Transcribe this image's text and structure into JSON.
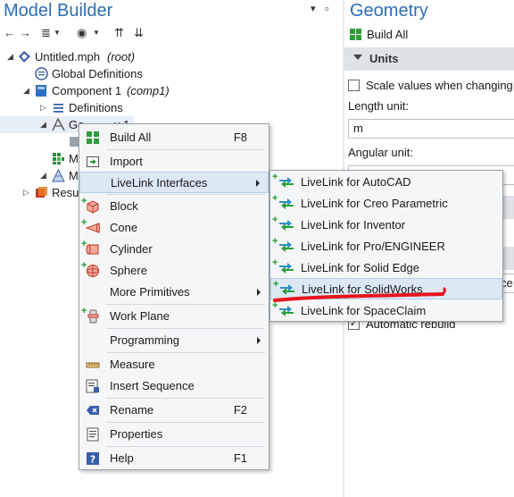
{
  "left_panel": {
    "title": "Model Builder",
    "pin_glyph": "▾",
    "close_glyph": "▫",
    "toolbar_icons": [
      "arrow-left-icon",
      "arrow-right-icon",
      "list-icon",
      "eye-icon",
      "sort-up-icon",
      "sort-down-icon"
    ]
  },
  "tree": {
    "root_label": "Untitled.mph",
    "root_tag": "(root)",
    "global_definitions": "Global Definitions",
    "component_label": "Component 1",
    "component_tag": "(comp1)",
    "definitions": "Definitions",
    "geometry_partial": "Ge",
    "geometry_partial_tail": "y 1",
    "mat_partial": "M",
    "mesh_partial": "M",
    "results_partial": "Resu"
  },
  "right_panel": {
    "title": "Geometry",
    "build_all": "Build All",
    "units_section": "Units",
    "scale_checkbox_label": "Scale values when changing u",
    "length_unit_label": "Length unit:",
    "length_unit_value": "m",
    "angular_unit_label": "Angular unit:",
    "tolerance_partial": "ce:",
    "auto_rebuild_label": "Automatic rebuild"
  },
  "context_menu": {
    "items": [
      {
        "label": "Build All",
        "shortcut": "F8",
        "icon": "build-all-icon"
      },
      {
        "label": "Import",
        "shortcut": "",
        "icon": "import-icon"
      },
      {
        "label": "LiveLink Interfaces",
        "shortcut": "",
        "icon": ""
      },
      {
        "label": "Block",
        "shortcut": "",
        "icon": "block-icon"
      },
      {
        "label": "Cone",
        "shortcut": "",
        "icon": "cone-icon"
      },
      {
        "label": "Cylinder",
        "shortcut": "",
        "icon": "cylinder-icon"
      },
      {
        "label": "Sphere",
        "shortcut": "",
        "icon": "sphere-icon"
      },
      {
        "label": "More Primitives",
        "shortcut": "",
        "icon": ""
      },
      {
        "label": "Work Plane",
        "shortcut": "",
        "icon": "work-plane-icon"
      },
      {
        "label": "Programming",
        "shortcut": "",
        "icon": ""
      },
      {
        "label": "Measure",
        "shortcut": "",
        "icon": "measure-icon"
      },
      {
        "label": "Insert Sequence",
        "shortcut": "",
        "icon": "insert-sequence-icon"
      },
      {
        "label": "Rename",
        "shortcut": "F2",
        "icon": "rename-icon"
      },
      {
        "label": "Properties",
        "shortcut": "",
        "icon": "properties-icon"
      },
      {
        "label": "Help",
        "shortcut": "F1",
        "icon": "help-icon"
      }
    ]
  },
  "livelink_menu": {
    "items": [
      {
        "label": "LiveLink for AutoCAD"
      },
      {
        "label": "LiveLink for Creo Parametric"
      },
      {
        "label": "LiveLink for Inventor"
      },
      {
        "label": "LiveLink for Pro/ENGINEER"
      },
      {
        "label": "LiveLink for Solid Edge"
      },
      {
        "label": "LiveLink for SolidWorks"
      },
      {
        "label": "LiveLink for SpaceClaim"
      }
    ]
  },
  "colors": {
    "title_blue": "#2e6db4",
    "highlight": "#dde8f5",
    "annotation_red": "#e8141c"
  }
}
